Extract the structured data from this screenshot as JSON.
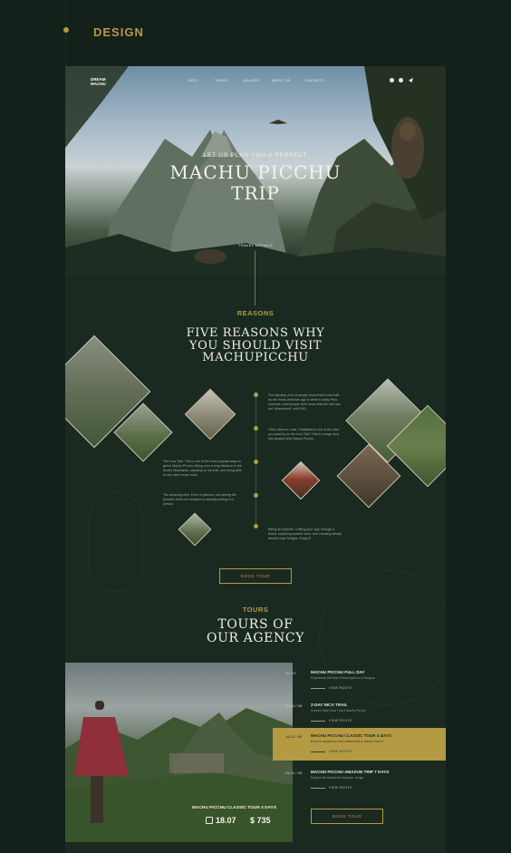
{
  "header": {
    "label": "DESIGN"
  },
  "nav": {
    "logo_line1": "DREAM",
    "logo_line2": "MACHU",
    "items": [
      "INFO",
      "TOURS",
      "GALLERY",
      "ABOUT US",
      "CONTACTS"
    ]
  },
  "hero": {
    "subtitle": "LET US PLAN YOU A PERFECT",
    "title_line1": "MACHU PICCHU",
    "title_line2": "TRIP",
    "link": "TRAVEL DETAILS"
  },
  "reasons": {
    "label": "REASONS",
    "title_line1": "FIVE REASONS WHY",
    "title_line2": "YOU SHOULD VISIT",
    "title_line3": "MACHUPICCHU",
    "items": [
      "The Mystery. A lot of people know that it was built by the Incas centuries ago in what is today Peru; however, most people don't know that the site was not \"discovered\" until 1911.",
      "Other sites en route. Patallacta is one of the sites you pass by on the Inca Trail. This is a large Inca site located near Machu Picchu.",
      "The Inca Trail. This is one of the most popular ways to get to Machu Picchu, hiking over a long distance in the Andes Mountains, camping on the trail, and being able to see other Incan ruins.",
      "The amazing view. Even in pictures, but seeing the pictures does not compare to actually seeing it in person.",
      "Being an explorer. Cutting your way through a forest, exploring ancient ruins, and crossing steady ancient rope bridges. Enjoy it!"
    ],
    "button": "BOOK TOUR"
  },
  "tours": {
    "label": "TOURS",
    "title_line1": "TOURS OF",
    "title_line2": "OUR AGENCY",
    "list": [
      {
        "date": "11 / 07",
        "title": "MACHU PICCHU FULL DAY",
        "desc": "Experience the best of Machupicchu & Huayna",
        "view": "VIEW ROUTE"
      },
      {
        "date": "12-14 / 08",
        "title": "2-DAY INCA TRAIL",
        "desc": "Explore Short Inca Trail & Machu Picchu",
        "view": "VIEW ROUTE"
      },
      {
        "date": "18-22 / 08",
        "title": "MACHU PICCHU CLASSIC TOUR 4 DAYS",
        "desc": "Explore mysterious Inca settlements & Machu Picchu",
        "view": "VIEW ROUTE"
      },
      {
        "date": "24-31 / 08",
        "title": "MACHU PICCHU AMAZON TRIP 7 DAYS",
        "desc": "Explore the Andes and Amazon Jungle",
        "view": "VIEW ROUTE"
      }
    ],
    "active_index": 2,
    "photo_caption": "MACHU PICCHU CLASSIC TOUR 4 DAYS",
    "photo_date": "18.07",
    "photo_price": "$ 735",
    "button": "BOOK TOUR"
  },
  "colors": {
    "accent": "#b59a44",
    "background": "#1a2a21",
    "text": "#f0ede2"
  }
}
